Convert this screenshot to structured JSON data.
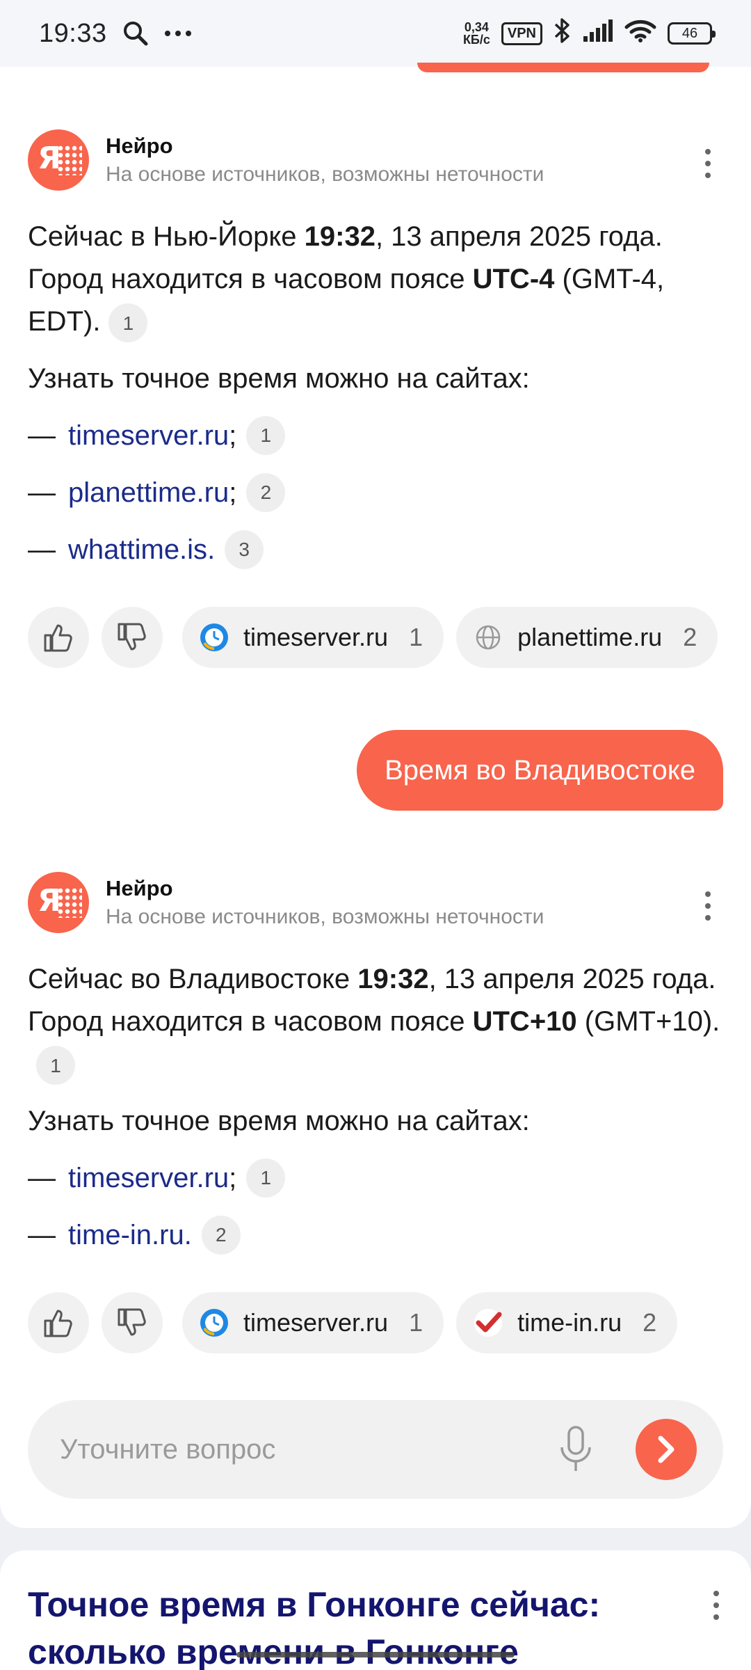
{
  "status_bar": {
    "time": "19:33",
    "net_speed_value": "0,34",
    "net_speed_unit": "КБ/с",
    "vpn": "VPN",
    "battery": "46"
  },
  "answers": [
    {
      "name": "Нейро",
      "subtitle": "На основе источников, возможны неточности",
      "para": {
        "t1": "Сейчас в Нью-Йорке ",
        "b1": "19:32",
        "t2": ", 13 апреля 2025 года. Город находится в часовом поясе ",
        "b2": "UTC-4",
        "t3": " (GMT-4, EDT).",
        "ref": "1"
      },
      "lead": "Узнать точное время можно на сайтах:",
      "links": [
        {
          "dash": "—",
          "text": "timeserver.ru",
          "punct": ";",
          "ref": "1"
        },
        {
          "dash": "—",
          "text": "planettime.ru",
          "punct": ";",
          "ref": "2"
        },
        {
          "dash": "—",
          "text": "whattime.is",
          "punct": ".",
          "ref": "3"
        }
      ],
      "sources": [
        {
          "label": "timeserver.ru",
          "num": "1",
          "icon": "clock-favicon-icon"
        },
        {
          "label": "planettime.ru",
          "num": "2",
          "icon": "globe-favicon-icon"
        }
      ]
    },
    {
      "name": "Нейро",
      "subtitle": "На основе источников, возможны неточности",
      "para": {
        "t1": "Сейчас во Владивостоке ",
        "b1": "19:32",
        "t2": ", 13 апреля 2025 года. Город находится в часовом поясе ",
        "b2": "UTC+10",
        "t3": " (GMT+10).",
        "ref": "1"
      },
      "lead": "Узнать точное время можно на сайтах:",
      "links": [
        {
          "dash": "—",
          "text": "timeserver.ru",
          "punct": ";",
          "ref": "1"
        },
        {
          "dash": "—",
          "text": "time-in.ru",
          "punct": ".",
          "ref": "2"
        }
      ],
      "sources": [
        {
          "label": "timeserver.ru",
          "num": "1",
          "icon": "clock-favicon-icon"
        },
        {
          "label": "time-in.ru",
          "num": "2",
          "icon": "checkmark-favicon-icon"
        }
      ]
    }
  ],
  "user_message": "Время во Владивостоке",
  "input": {
    "placeholder": "Уточните вопрос",
    "value": ""
  },
  "search_result": {
    "title": "Точное время в Гонконге сейчас: сколько времени в Гонконге"
  },
  "colors": {
    "accent": "#f8644c",
    "link": "#1b2b8a",
    "result_title": "#14156e"
  }
}
